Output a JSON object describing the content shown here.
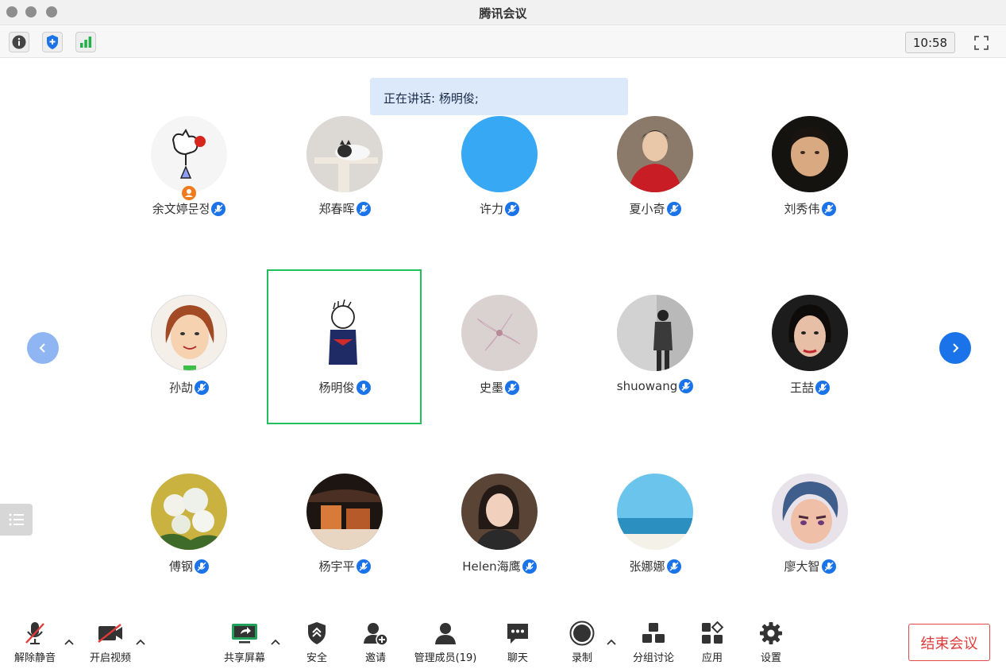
{
  "window": {
    "title": "腾讯会议"
  },
  "infobar": {
    "info_icon": "info-icon",
    "security_icon": "shield-icon",
    "signal_icon": "signal-bars-icon",
    "clock": "10:58",
    "fullscreen_icon": "fullscreen-icon"
  },
  "speaking": {
    "text": "正在讲话: 杨明俊;"
  },
  "participants": [
    {
      "name": "余文婷문정"
    },
    {
      "name": "郑春晖"
    },
    {
      "name": "许力"
    },
    {
      "name": "夏小奇"
    },
    {
      "name": "刘秀伟"
    },
    {
      "name": "孙劼"
    },
    {
      "name": "杨明俊"
    },
    {
      "name": "史墨"
    },
    {
      "name": "shuowang"
    },
    {
      "name": "王喆"
    },
    {
      "name": "傅钢"
    },
    {
      "name": "杨宇平"
    },
    {
      "name": "Helen海鹰"
    },
    {
      "name": "张娜娜"
    },
    {
      "name": "廖大智"
    }
  ],
  "toolbar": {
    "unmute": "解除静音",
    "start_video": "开启视频",
    "share_screen": "共享屏幕",
    "security": "安全",
    "invite": "邀请",
    "manage_members": "管理成员(19)",
    "chat": "聊天",
    "record": "录制",
    "breakout": "分组讨论",
    "apps": "应用",
    "settings": "设置",
    "end_meeting": "结束会议"
  },
  "colors": {
    "accent": "#1a73e8",
    "active_speaker": "#22c05a",
    "end": "#e03a3a",
    "banner": "#dce9fb"
  }
}
